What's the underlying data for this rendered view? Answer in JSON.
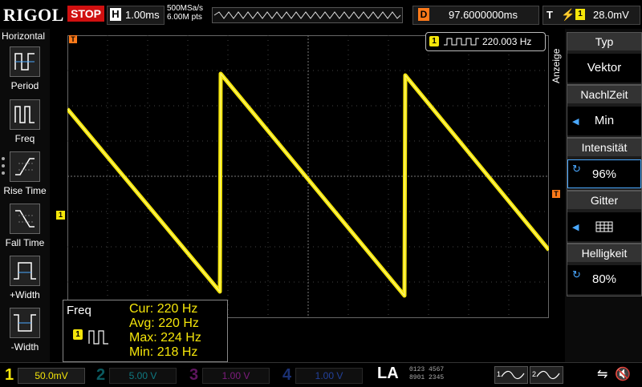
{
  "topbar": {
    "brand": "RIGOL",
    "run_state": "STOP",
    "horizontal_label": "H",
    "timebase": "1.00ms",
    "sample_rate": "500MSa/s",
    "memory_depth": "6.00M pts",
    "delay_label": "D",
    "delay_value": "97.6000000ms",
    "trigger_label": "T",
    "trigger_channel": "1",
    "trigger_level": "28.0mV"
  },
  "left_panel": {
    "title": "Horizontal",
    "items": [
      {
        "label": "Period",
        "icon": "period-icon"
      },
      {
        "label": "Freq",
        "icon": "frequency-icon"
      },
      {
        "label": "Rise Time",
        "icon": "rise-time-icon"
      },
      {
        "label": "Fall Time",
        "icon": "fall-time-icon"
      },
      {
        "label": "+Width",
        "icon": "positive-width-icon"
      },
      {
        "label": "-Width",
        "icon": "negative-width-icon"
      }
    ]
  },
  "screen": {
    "channel_marker": "1",
    "trigger_marker": "T",
    "freq_badge_channel": "1",
    "freq_badge_value": "220.003 Hz"
  },
  "measurement": {
    "title": "Freq",
    "channel": "1",
    "rows": [
      {
        "label": "Cur:",
        "value": "220 Hz"
      },
      {
        "label": "Avg:",
        "value": "220 Hz"
      },
      {
        "label": "Max:",
        "value": "224 Hz"
      },
      {
        "label": "Min:",
        "value": "218 Hz"
      }
    ]
  },
  "right_menu": {
    "side_label": "Anzeige",
    "buttons": [
      {
        "title": "Typ",
        "value": "Vektor"
      },
      {
        "title": "NachlZeit",
        "value": "Min"
      },
      {
        "title": "Intensität",
        "value": "96%"
      },
      {
        "title": "Gitter",
        "value": ""
      },
      {
        "title": "Helligkeit",
        "value": "80%"
      }
    ]
  },
  "bottombar": {
    "channels": [
      {
        "num": "1",
        "scale": "50.0mV",
        "color": "#f5e60a"
      },
      {
        "num": "2",
        "scale": "5.00 V",
        "color": "#19c8d6"
      },
      {
        "num": "3",
        "scale": "1.00 V",
        "color": "#d030d0"
      },
      {
        "num": "4",
        "scale": "1.00 V",
        "color": "#3a6cff"
      }
    ],
    "la_label": "LA",
    "la_digits_top": "0123 4567",
    "la_digits_bottom": "8901 2345",
    "gen1": "1",
    "gen2": "2"
  },
  "colors": {
    "trace": "#f5e60a",
    "accent_orange": "#ff7a1a",
    "stop_red": "#d01010"
  }
}
